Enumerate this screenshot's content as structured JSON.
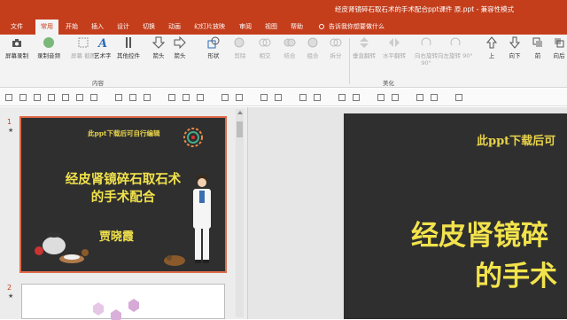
{
  "window": {
    "title": "经皮肾镜碎石取石术的手术配合ppt课件 原.ppt - 兼容性模式"
  },
  "tabs": [
    "文件",
    "常用",
    "开始",
    "插入",
    "设计",
    "切换",
    "动画",
    "幻灯片放映",
    "审阅",
    "视图",
    "帮助"
  ],
  "active_tab": "常用",
  "tellme": "告诉我你想要做什么",
  "ribbon": {
    "buttons": {
      "screen_record": "屏幕录制",
      "record_audio": "录制音频",
      "screen_capture": "屏幕\n截图",
      "art": "艺术字",
      "other": "其他控件",
      "arrow_right": "箭头",
      "arrow_left": "箭头",
      "shapes": "形状",
      "remove": "剪除",
      "intersect": "相交",
      "combine": "结合",
      "group": "组合",
      "split": "拆分",
      "flip_v": "垂直翻转",
      "flip_h": "水平翻转",
      "rotate_r": "向右旋转 90°",
      "rotate_l": "向左旋转 90°",
      "up": "上",
      "down": "向下",
      "front": "前",
      "back": "向后"
    },
    "group_labels": {
      "content": "内容",
      "beautify": "美化"
    }
  },
  "slides": [
    {
      "number": "1",
      "star": "★",
      "subtitle": "此ppt下载后可自行编辑",
      "title_line1": "经皮肾镜碎石取石术",
      "title_line2": "的手术配合",
      "author": "贾晓霞"
    },
    {
      "number": "2",
      "star": "★"
    }
  ],
  "main_slide": {
    "subtitle": "此ppt下载后可",
    "title_line1": "经皮肾镜碎",
    "title_line2": "的手术"
  },
  "colors": {
    "accent": "#c43e1c",
    "slide_bg": "#2f2f2f",
    "title_yellow": "#f2e34c"
  }
}
